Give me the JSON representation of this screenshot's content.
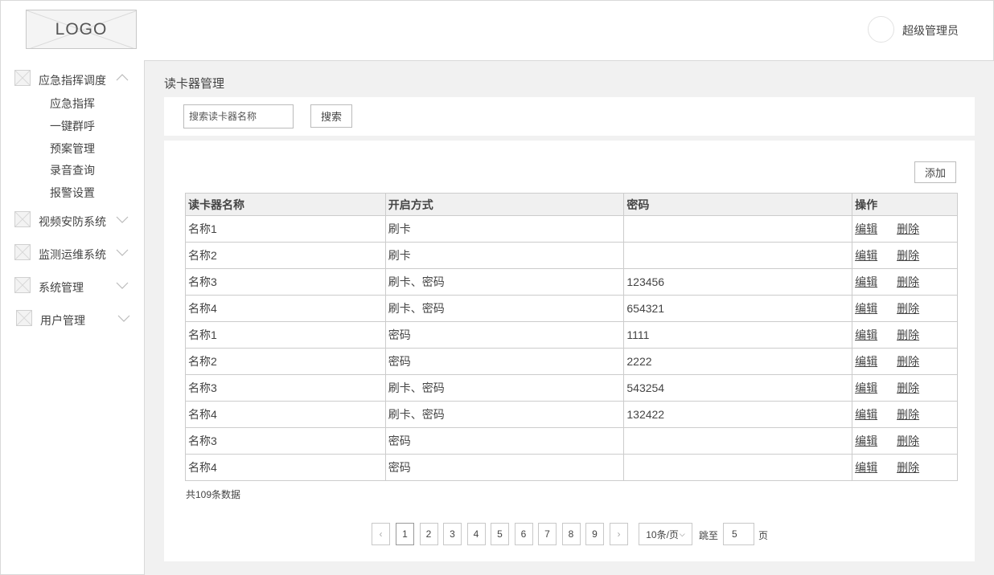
{
  "header": {
    "logo_text": "LOGO",
    "username": "超级管理员"
  },
  "sidebar": {
    "groups": [
      {
        "label": "应急指挥调度",
        "expanded": true,
        "items": [
          "应急指挥",
          "一键群呼",
          "预案管理",
          "录音查询",
          "报警设置"
        ]
      },
      {
        "label": "视频安防系统",
        "expanded": false
      },
      {
        "label": "监测运维系统",
        "expanded": false
      },
      {
        "label": "系统管理",
        "expanded": false
      },
      {
        "label": "用户管理",
        "expanded": false
      }
    ]
  },
  "main": {
    "page_title": "读卡器管理",
    "search": {
      "placeholder": "搜索读卡器名称",
      "button_label": "搜索"
    },
    "add_label": "添加",
    "table": {
      "columns": [
        "读卡器名称",
        "开启方式",
        "密码",
        "操作"
      ],
      "edit_label": "编辑",
      "delete_label": "删除",
      "rows": [
        [
          "名称1",
          "刷卡",
          ""
        ],
        [
          "名称2",
          "刷卡",
          ""
        ],
        [
          "名称3",
          "刷卡、密码",
          "123456"
        ],
        [
          "名称4",
          "刷卡、密码",
          "654321"
        ],
        [
          "名称1",
          "密码",
          "1111"
        ],
        [
          "名称2",
          "密码",
          "2222"
        ],
        [
          "名称3",
          "刷卡、密码",
          "543254"
        ],
        [
          "名称4",
          "刷卡、密码",
          "132422"
        ],
        [
          "名称3",
          "密码",
          ""
        ],
        [
          "名称4",
          "密码",
          ""
        ]
      ]
    },
    "total_text": "共109条数据",
    "pagination": {
      "prev": "‹",
      "next": "›",
      "pages": [
        "1",
        "2",
        "3",
        "4",
        "5",
        "6",
        "7",
        "8",
        "9"
      ],
      "current": "1",
      "page_size": "10条/页",
      "jump_label": "跳至",
      "jump_value": "5",
      "page_unit": "页"
    }
  }
}
